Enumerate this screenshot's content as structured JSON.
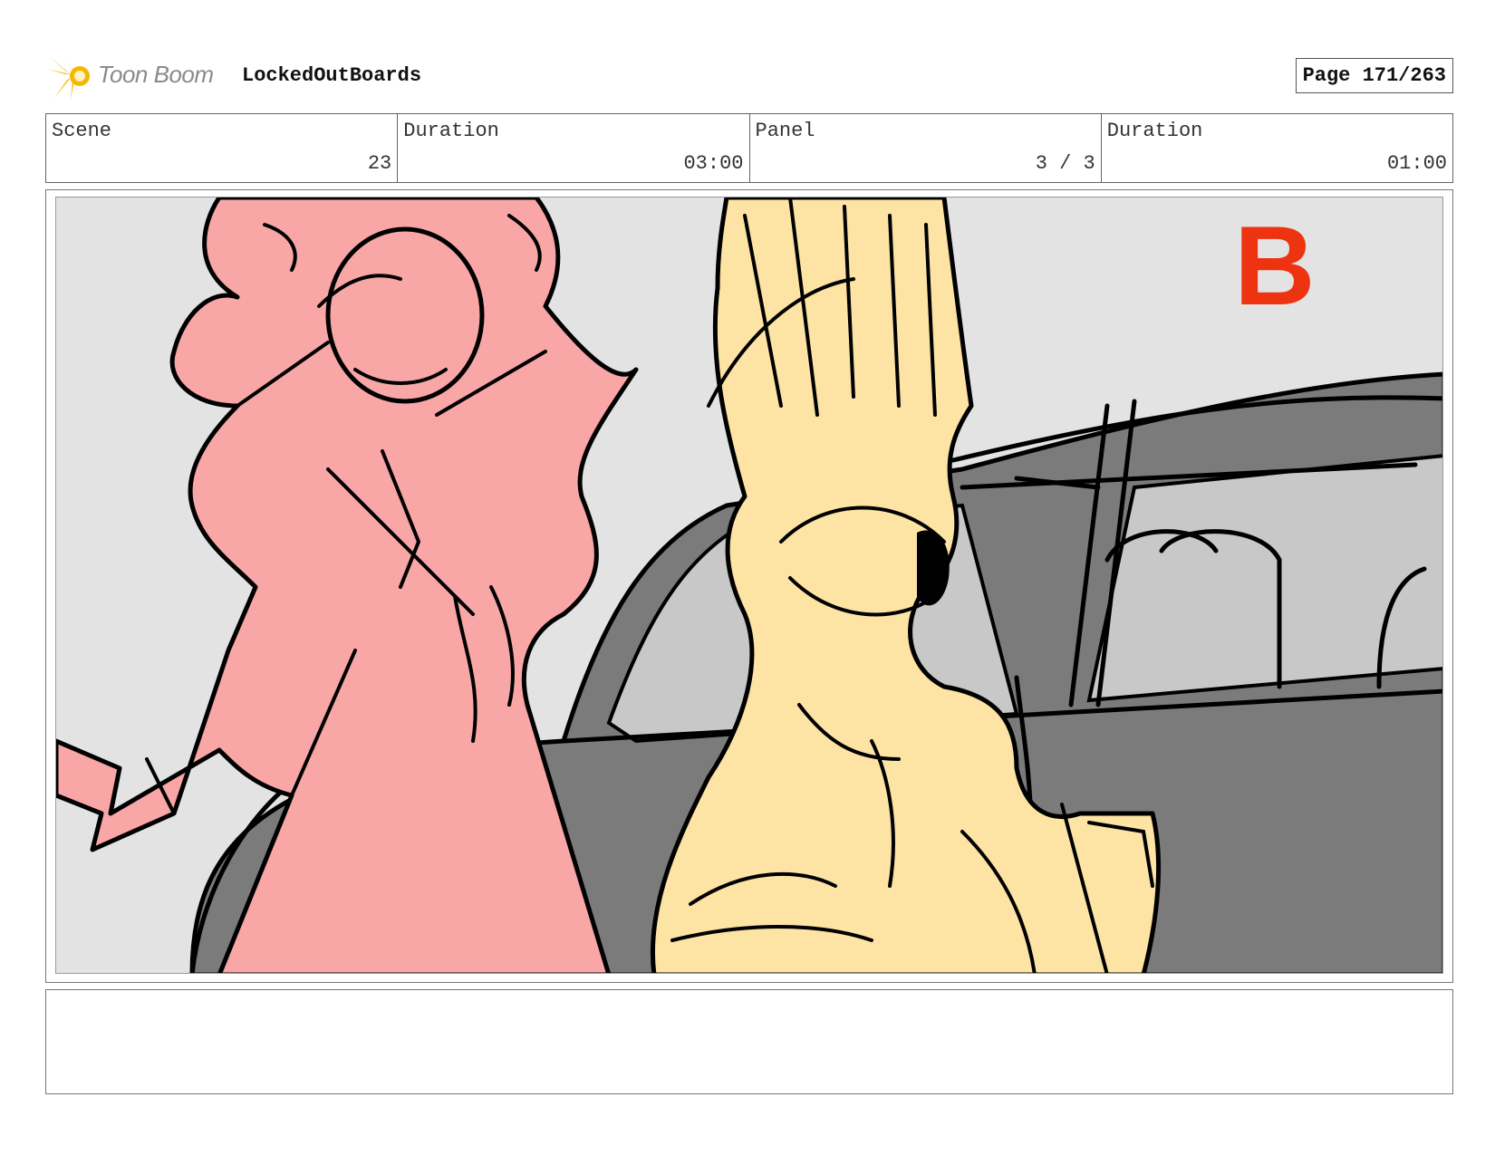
{
  "header": {
    "logo_text": "Toon Boom",
    "project_name": "LockedOutBoards",
    "page_label": "Page 171/263"
  },
  "info": {
    "scene_label": "Scene",
    "scene_value": "23",
    "scene_duration_label": "Duration",
    "scene_duration_value": "03:00",
    "panel_label": "Panel",
    "panel_value": "3 / 3",
    "panel_duration_label": "Duration",
    "panel_duration_value": "01:00"
  },
  "drawing": {
    "marker_letter": "B",
    "colors": {
      "background": "#e3e3e3",
      "car_body": "#7b7b7b",
      "car_window": "#c8c8c8",
      "pink_character": "#f9a6a6",
      "yellow_character": "#fde4a4",
      "ink": "#000000",
      "marker": "#ee3311"
    }
  },
  "notes": {
    "text": ""
  }
}
